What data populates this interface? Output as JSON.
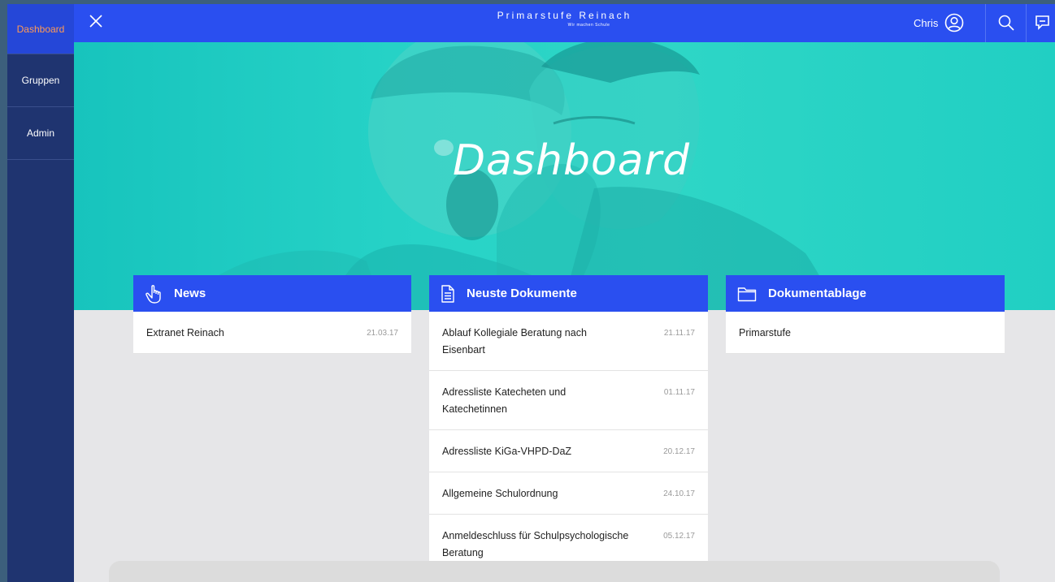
{
  "sidebar": {
    "items": [
      {
        "label": "Dashboard",
        "active": true
      },
      {
        "label": "Gruppen",
        "active": false
      },
      {
        "label": "Admin",
        "active": false
      }
    ]
  },
  "topbar": {
    "brand_title": "Primarstufe Reinach",
    "brand_subtitle": "Wir machen Schule",
    "user_name": "Chris",
    "icons": [
      "close-icon",
      "user-circle-icon",
      "search-icon",
      "chat-icon"
    ]
  },
  "hero": {
    "title": "Dashboard"
  },
  "cards": {
    "news": {
      "title": "News",
      "icon": "hand-pointer-icon",
      "rows": [
        {
          "title": "Extranet Reinach",
          "date": "21.03.17"
        }
      ]
    },
    "documents": {
      "title": "Neuste Dokumente",
      "icon": "document-icon",
      "rows": [
        {
          "title": "Ablauf Kollegiale Beratung nach Eisenbart",
          "date": "21.11.17"
        },
        {
          "title": "Adressliste Katecheten und Katechetinnen",
          "date": "01.11.17"
        },
        {
          "title": "Adressliste KiGa-VHPD-DaZ",
          "date": "20.12.17"
        },
        {
          "title": "Allgemeine Schulordnung",
          "date": "24.10.17"
        },
        {
          "title": "Anmeldeschluss für Schulpsychologische Beratung",
          "date": "05.12.17"
        }
      ]
    },
    "storage": {
      "title": "Dokumentablage",
      "icon": "folder-icon",
      "rows": [
        {
          "title": "Primarstufe"
        }
      ]
    }
  },
  "colors": {
    "accent": "#2a4ff0",
    "sidebar": "#1f3470",
    "active_label": "#ff9a55",
    "hero": "#27d3c7",
    "background": "#e6e6e8"
  }
}
